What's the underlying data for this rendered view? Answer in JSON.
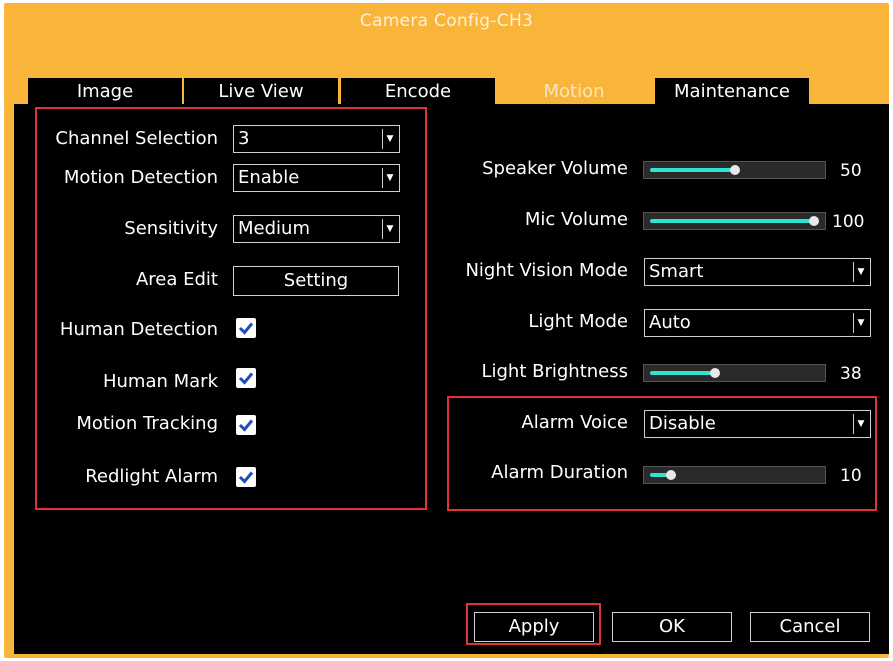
{
  "window": {
    "title": "Camera Config-CH3"
  },
  "tabs": [
    {
      "label": "Image",
      "active": false
    },
    {
      "label": "Live View",
      "active": false
    },
    {
      "label": "Encode",
      "active": false
    },
    {
      "label": "Motion",
      "active": true
    },
    {
      "label": "Maintenance",
      "active": false
    }
  ],
  "left": {
    "channel_selection": {
      "label": "Channel Selection",
      "value": "3"
    },
    "motion_detection": {
      "label": "Motion Detection",
      "value": "Enable"
    },
    "sensitivity": {
      "label": "Sensitivity",
      "value": "Medium"
    },
    "area_edit": {
      "label": "Area Edit",
      "button": "Setting"
    },
    "human_detection": {
      "label": "Human Detection",
      "checked": true
    },
    "human_mark": {
      "label": "Human Mark",
      "checked": true
    },
    "motion_tracking": {
      "label": "Motion Tracking",
      "checked": true
    },
    "redlight_alarm": {
      "label": "Redlight Alarm",
      "checked": true
    }
  },
  "right": {
    "speaker_volume": {
      "label": "Speaker Volume",
      "value": "50",
      "level": 0.5
    },
    "mic_volume": {
      "label": "Mic Volume",
      "value": "100",
      "level": 1.0
    },
    "night_vision_mode": {
      "label": "Night Vision Mode",
      "value": "Smart"
    },
    "light_mode": {
      "label": "Light Mode",
      "value": "Auto"
    },
    "light_brightness": {
      "label": "Light Brightness",
      "value": "38",
      "level": 0.38
    },
    "alarm_voice": {
      "label": "Alarm Voice",
      "value": "Disable"
    },
    "alarm_duration": {
      "label": "Alarm Duration",
      "value": "10",
      "level": 0.1
    }
  },
  "footer": {
    "apply": "Apply",
    "ok": "OK",
    "cancel": "Cancel"
  },
  "colors": {
    "accent": "#f9b43a",
    "slider_fill": "#2ee4d0",
    "highlight": "#e0303a"
  }
}
